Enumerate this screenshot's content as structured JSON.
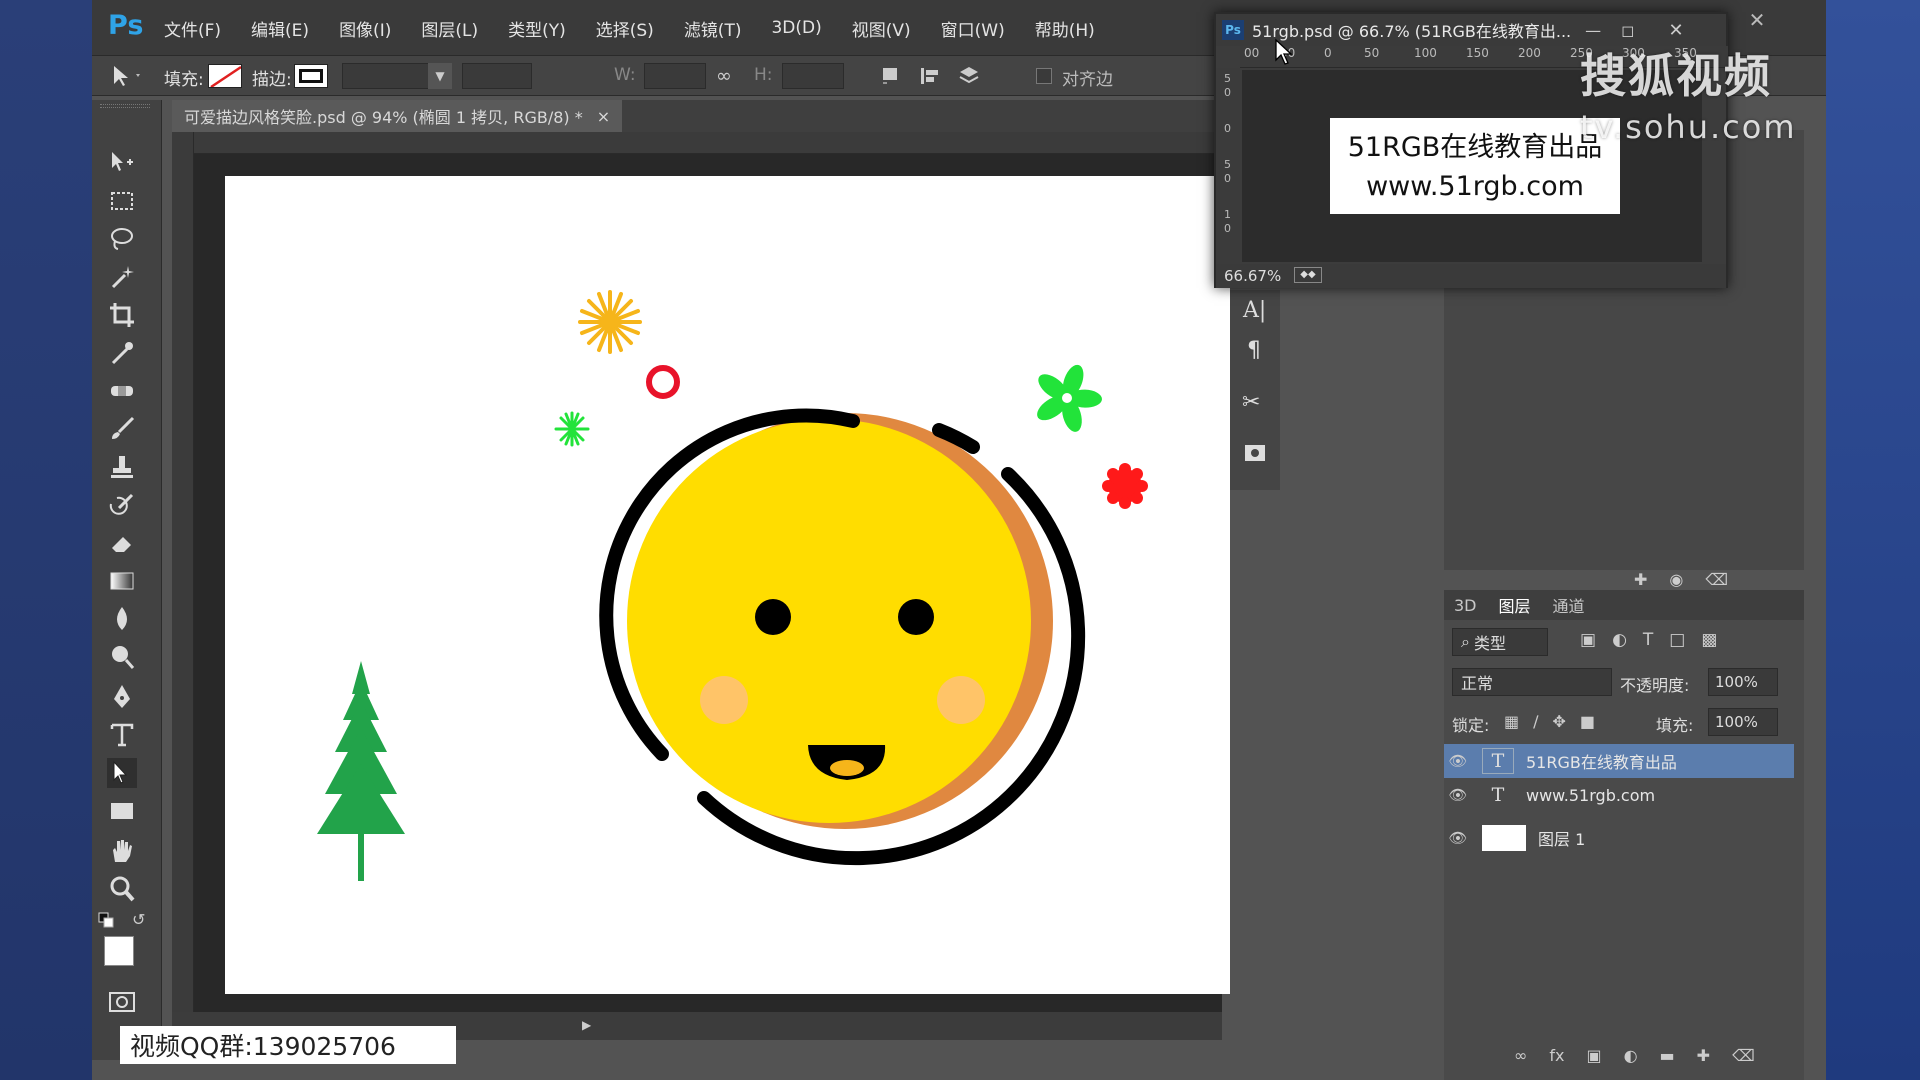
{
  "app": {
    "logo": "Ps"
  },
  "menu": [
    "文件(F)",
    "编辑(E)",
    "图像(I)",
    "图层(L)",
    "类型(Y)",
    "选择(S)",
    "滤镜(T)",
    "3D(D)",
    "视图(V)",
    "窗口(W)",
    "帮助(H)"
  ],
  "options": {
    "fill_label": "填充:",
    "stroke_label": "描边:",
    "w_label": "W:",
    "h_label": "H:",
    "align_label": "对齐边"
  },
  "document": {
    "tab_title": "可爱描边风格笑脸.psd @ 94% (椭圆 1 拷贝, RGB/8) *",
    "tab_close": "×"
  },
  "floating_window": {
    "title": "51rgb.psd @ 66.7% (51RGB在线教育出...",
    "ruler_top": [
      "00",
      "50",
      "0",
      "50",
      "100",
      "150",
      "200",
      "250",
      "300",
      "350"
    ],
    "ruler_left": [
      "5",
      "0",
      "0",
      "5",
      "0",
      "1",
      "0"
    ],
    "line1": "51RGB在线教育出品",
    "line2": "www.51rgb.com",
    "zoom": "66.67%"
  },
  "layers_panel": {
    "tabs": [
      "3D",
      "图层",
      "通道"
    ],
    "filter_label": "类型",
    "blend_mode": "正常",
    "opacity_label": "不透明度:",
    "opacity_value": "100%",
    "lock_label": "锁定:",
    "fill_label": "填充:",
    "fill_value": "100%",
    "layers": [
      {
        "name": "51RGB在线教育出品",
        "type": "text",
        "selected": true
      },
      {
        "name": "www.51rgb.com",
        "type": "text",
        "selected": false
      },
      {
        "name": "图层 1",
        "type": "pixel",
        "selected": false
      }
    ]
  },
  "right_panel_badge": "3D",
  "watermark": {
    "line1": "搜狐视频",
    "line2": "tv.sohu.com"
  },
  "qq_group": "视频QQ群:139025706",
  "colors": {
    "accent_blue": "#2fa3e7",
    "selection": "#5b7dad",
    "face_yellow": "#ffdd00",
    "face_shadow": "#e08840",
    "tree_green": "#22a34a",
    "star_orange": "#f6b51a",
    "ring_red": "#e8132a",
    "flower_green": "#22e33a",
    "flower_red": "#ff1a1a",
    "cheek": "#ffc07a"
  }
}
